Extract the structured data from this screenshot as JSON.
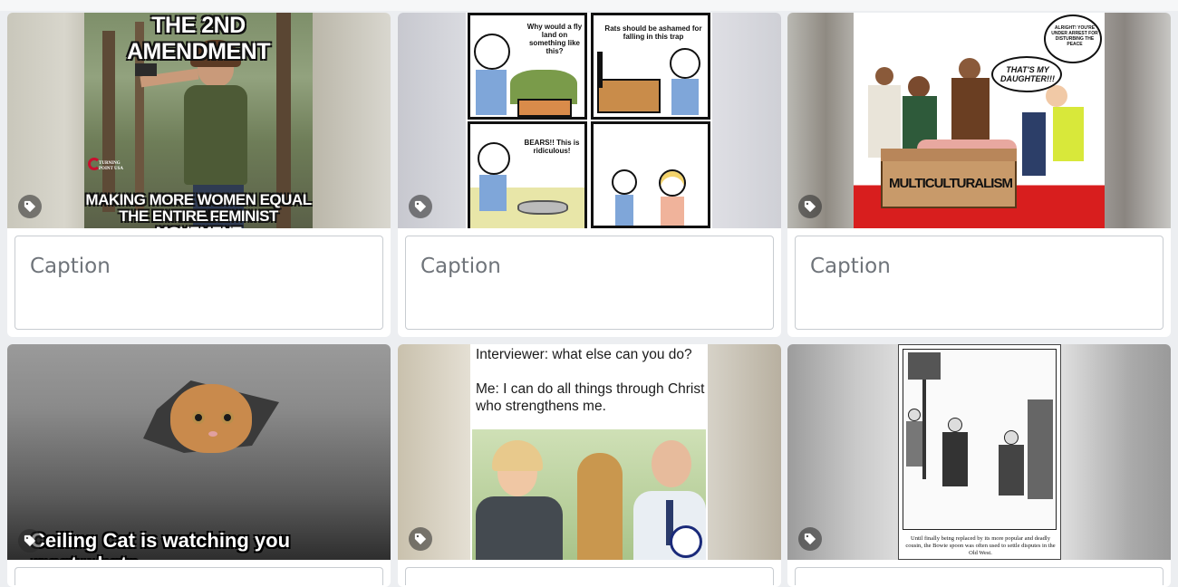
{
  "cards": [
    {
      "meme_top": "THE 2ND AMENDMENT",
      "meme_bottom_1": "MAKING MORE WOMEN EQUAL THAN",
      "meme_bottom_2": "THE ENTIRE FEMINIST MOVEMENT",
      "logo_text": "TURNING POINT USA",
      "caption_placeholder": "Caption"
    },
    {
      "panel1": "Why would a fly land on something like this?",
      "panel2": "Rats should be ashamed for falling in this trap",
      "panel3": "BEARS!! This is ridiculous!",
      "caption_placeholder": "Caption"
    },
    {
      "bubble1": "THAT'S MY DAUGHTER!!!",
      "bubble2": "ALRIGHT! YOU'RE UNDER ARREST FOR DISTURBING THE PEACE",
      "sign": "MULTICULTURALISM",
      "caption_placeholder": "Caption"
    },
    {
      "meme_text": "Ceiling Cat is watching you masturbate."
    },
    {
      "line1": "Interviewer: what else can you do?",
      "line2": "Me: I can do all things through Christ",
      "line3": "who strengthens me."
    },
    {
      "cartoon_caption": "Until finally being replaced by its more popular and deadly cousin, the Bowie spoon was often used to settle disputes in the Old West."
    }
  ],
  "icons": {
    "tag": "tag-icon"
  }
}
